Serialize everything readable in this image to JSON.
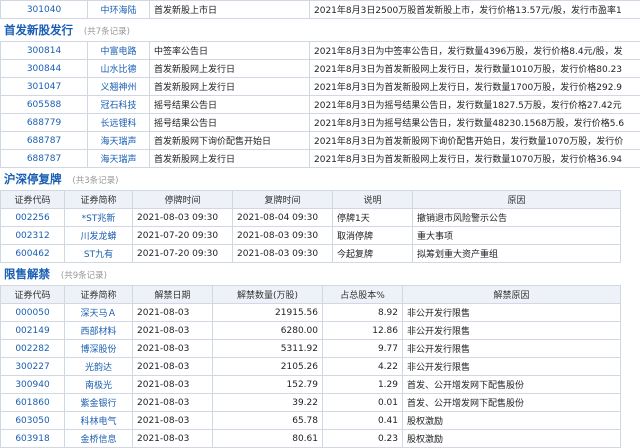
{
  "top_rows": [
    {
      "code": "301040",
      "name": "中环海陆",
      "event": "首发新股上市日",
      "desc": "2021年8月3日2500万股首发新股上市，发行价格13.57元/股，发行市盈率1"
    }
  ],
  "ipo": {
    "title": "首发新股发行",
    "count": "(共7条记录)",
    "rows": [
      {
        "code": "300814",
        "name": "中富电路",
        "event": "中签率公告日",
        "desc": "2021年8月3日为中签率公告日，发行数量4396万股，发行价格8.4元/股，发"
      },
      {
        "code": "300844",
        "name": "山水比德",
        "event": "首发新股网上发行日",
        "desc": "2021年8月3日为首发新股网上发行日，发行数量1010万股，发行价格80.23"
      },
      {
        "code": "301047",
        "name": "义翘神州",
        "event": "首发新股网上发行日",
        "desc": "2021年8月3日为首发新股网上发行日，发行数量1700万股，发行价格292.9"
      },
      {
        "code": "605588",
        "name": "冠石科技",
        "event": "摇号结果公告日",
        "desc": "2021年8月3日为摇号结果公告日，发行数量1827.5万股，发行价格27.42元"
      },
      {
        "code": "688779",
        "name": "长远锂科",
        "event": "摇号结果公告日",
        "desc": "2021年8月3日为摇号结果公告日，发行数量48230.1568万股，发行价格5.6"
      },
      {
        "code": "688787",
        "name": "海天瑞声",
        "event": "首发新股网下询价配售开始日",
        "desc": "2021年8月3日为首发新股网下询价配售开始日，发行数量1070万股，发行价"
      },
      {
        "code": "688787",
        "name": "海天瑞声",
        "event": "首发新股网上发行日",
        "desc": "2021年8月3日为首发新股网上发行日，发行数量1070万股，发行价格36.94"
      }
    ]
  },
  "suspend": {
    "title": "沪深停复牌",
    "count": "(共3条记录)",
    "headers": [
      "证券代码",
      "证券简称",
      "停牌时间",
      "复牌时间",
      "说明",
      "原因"
    ],
    "rows": [
      {
        "code": "002256",
        "name": "*ST兆新",
        "stop": "2021-08-03 09:30",
        "resume": "2021-08-04 09:30",
        "note": "停牌1天",
        "reason": "撤销退市风险警示公告"
      },
      {
        "code": "002312",
        "name": "川发龙蟒",
        "stop": "2021-07-20 09:30",
        "resume": "2021-08-03 09:30",
        "note": "取消停牌",
        "reason": "重大事项"
      },
      {
        "code": "600462",
        "name": "ST九有",
        "stop": "2021-07-20 09:30",
        "resume": "2021-08-03 09:30",
        "note": "今起复牌",
        "reason": "拟筹划重大资产重组"
      }
    ]
  },
  "unlock": {
    "title": "限售解禁",
    "count": "(共9条记录)",
    "headers": [
      "证券代码",
      "证券简称",
      "解禁日期",
      "解禁数量(万股)",
      "占总股本%",
      "解禁原因"
    ],
    "rows": [
      {
        "code": "000050",
        "name": "深天马Ａ",
        "date": "2021-08-03",
        "qty": "21915.56",
        "pct": "8.92",
        "reason": "非公开发行限售"
      },
      {
        "code": "002149",
        "name": "西部材料",
        "date": "2021-08-03",
        "qty": "6280.00",
        "pct": "12.86",
        "reason": "非公开发行限售"
      },
      {
        "code": "002282",
        "name": "博深股份",
        "date": "2021-08-03",
        "qty": "5311.92",
        "pct": "9.77",
        "reason": "非公开发行限售"
      },
      {
        "code": "300227",
        "name": "光韵达",
        "date": "2021-08-03",
        "qty": "2105.26",
        "pct": "4.22",
        "reason": "非公开发行限售"
      },
      {
        "code": "300940",
        "name": "南极光",
        "date": "2021-08-03",
        "qty": "152.79",
        "pct": "1.29",
        "reason": "首发、公开增发网下配售股份"
      },
      {
        "code": "601860",
        "name": "紫金银行",
        "date": "2021-08-03",
        "qty": "39.22",
        "pct": "0.01",
        "reason": "首发、公开增发网下配售股份"
      },
      {
        "code": "603050",
        "name": "科林电气",
        "date": "2021-08-03",
        "qty": "65.78",
        "pct": "0.41",
        "reason": "股权激励"
      },
      {
        "code": "603918",
        "name": "金桥信息",
        "date": "2021-08-03",
        "qty": "80.61",
        "pct": "0.23",
        "reason": "股权激励"
      }
    ]
  }
}
